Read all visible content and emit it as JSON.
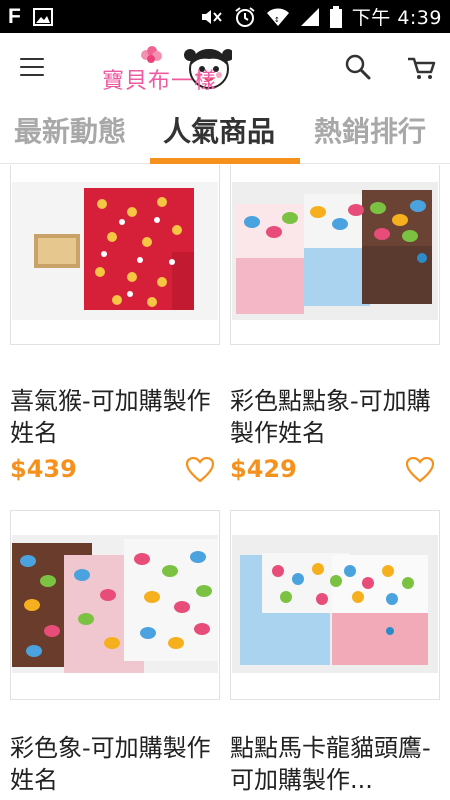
{
  "status_bar": {
    "carrier_glyph": "F",
    "time": "下午 4:39",
    "icons": [
      "notification-f-icon",
      "gallery-icon",
      "mute-icon",
      "alarm-icon",
      "wifi-icon",
      "signal-icon",
      "battery-icon"
    ]
  },
  "app_bar": {
    "logo_text": "寶貝布一樣",
    "icons": [
      "menu-icon",
      "search-icon",
      "cart-icon"
    ]
  },
  "tabs": [
    {
      "label": "最新動態",
      "active": false
    },
    {
      "label": "人氣商品",
      "active": true
    },
    {
      "label": "熱銷排行",
      "active": false
    }
  ],
  "colors": {
    "accent": "#f5921e",
    "logo_pink": "#ef5ba1"
  },
  "products": [
    {
      "title": "喜氣猴-可加購製作姓名",
      "price": "$439",
      "image": "red-monkey-fabric-book-cover"
    },
    {
      "title": "彩色點點象-可加購製作姓名",
      "price": "$429",
      "image": "elephant-polka-dot-fabric-covers"
    },
    {
      "title": "彩色象-可加購製作姓名",
      "price": "",
      "image": "colorful-elephant-fabric-covers"
    },
    {
      "title": "點點馬卡龍貓頭鷹-可加購製作...",
      "price": "",
      "image": "owl-macaron-fabric-covers"
    }
  ]
}
